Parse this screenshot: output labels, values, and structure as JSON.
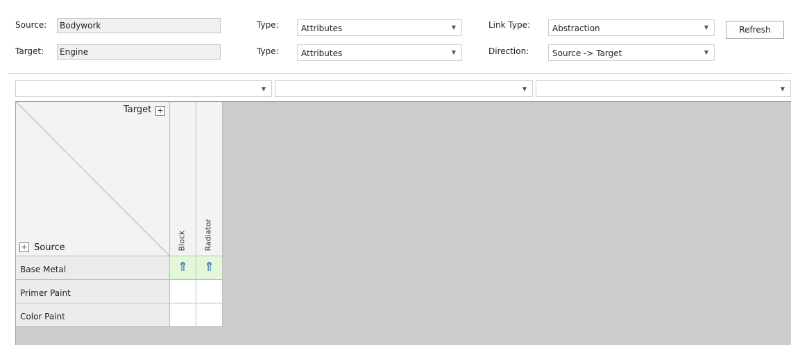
{
  "header": {
    "source_label": "Source:",
    "source_value": "Bodywork",
    "target_label": "Target:",
    "target_value": "Engine",
    "source_type_label": "Type:",
    "source_type_value": "Attributes",
    "target_type_label": "Type:",
    "target_type_value": "Attributes",
    "link_type_label": "Link Type:",
    "link_type_value": "Abstraction",
    "direction_label": "Direction:",
    "direction_value": "Source -> Target",
    "refresh_label": "Refresh"
  },
  "filters": [
    "",
    "",
    ""
  ],
  "matrix": {
    "corner_target_label": "Target",
    "corner_source_label": "Source",
    "plus_symbol": "+",
    "columns": [
      "Block",
      "Radiator"
    ],
    "rows": [
      {
        "label": "Base Metal",
        "cells": [
          "⇑",
          "⇑"
        ]
      },
      {
        "label": "Primer Paint",
        "cells": [
          "",
          ""
        ]
      },
      {
        "label": "Color Paint",
        "cells": [
          "",
          ""
        ]
      }
    ]
  },
  "colors": {
    "link_cell_bg": "#e3f7d9",
    "arrow": "#2a5aa8",
    "grid_bg": "#cccccc"
  },
  "icons": {
    "dropdown": "chevron-down-icon",
    "link": "up-arrow-icon"
  }
}
